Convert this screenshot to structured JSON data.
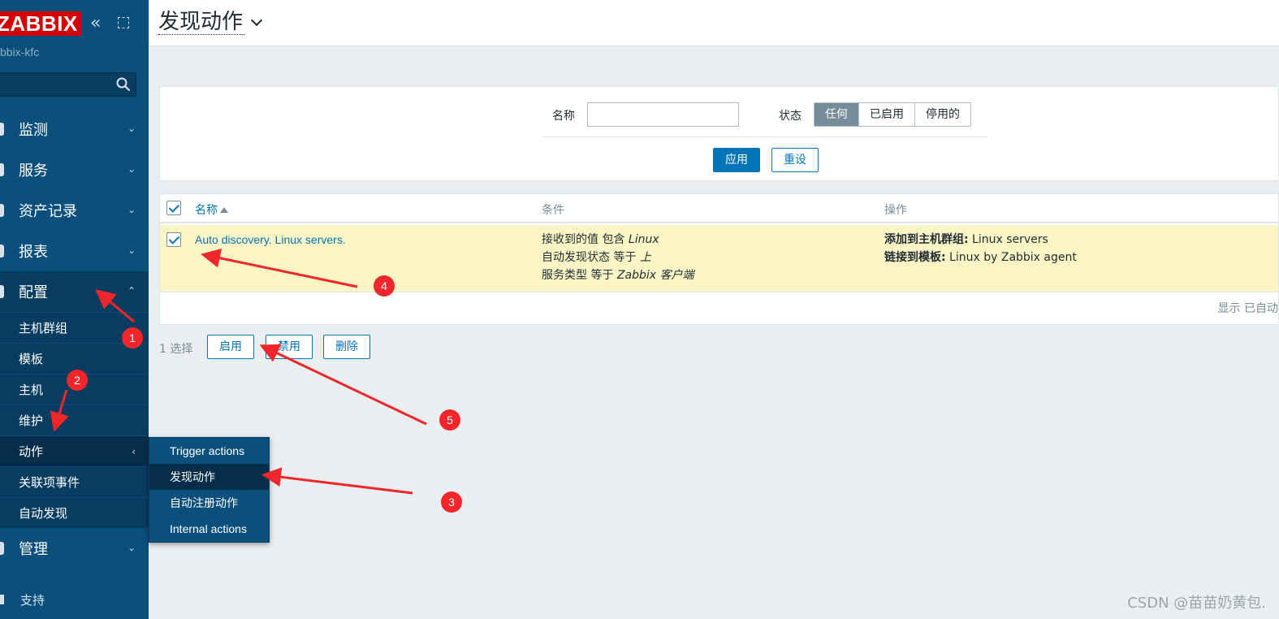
{
  "sidebar": {
    "logo": "ZABBIX",
    "server_name": "bbix-kfc",
    "collapse_icon": "«",
    "menu": [
      {
        "label": "监测",
        "chevron": "⌄"
      },
      {
        "label": "服务",
        "chevron": "⌄"
      },
      {
        "label": "资产记录",
        "chevron": "⌄"
      },
      {
        "label": "报表",
        "chevron": "⌄"
      },
      {
        "label": "配置",
        "chevron": "⌃"
      }
    ],
    "config_submenu": [
      "主机群组",
      "模板",
      "主机",
      "维护",
      "动作",
      "关联项事件",
      "自动发现"
    ],
    "submenu_chevron": "‹",
    "admin": {
      "label": "管理",
      "chevron": "⌄"
    },
    "support": "支持"
  },
  "flyout": [
    "Trigger actions",
    "发现动作",
    "自动注册动作",
    "Internal actions"
  ],
  "header": {
    "title": "发现动作"
  },
  "filter": {
    "name_label": "名称",
    "name_value": "",
    "status_label": "状态",
    "status_options": [
      "任何",
      "已启用",
      "停用的"
    ],
    "apply": "应用",
    "reset": "重设"
  },
  "table": {
    "columns": [
      "名称",
      "条件",
      "操作"
    ],
    "row": {
      "name": "Auto discovery. Linux servers.",
      "conditions": [
        {
          "text": "接收到的值 包含 ",
          "value": "Linux"
        },
        {
          "text": "自动发现状态 等于 ",
          "value": "上"
        },
        {
          "text": "服务类型 等于 ",
          "value": "Zabbix 客户端"
        }
      ],
      "operations": [
        {
          "label": "添加到主机群组:",
          "value": " Linux servers"
        },
        {
          "label": "链接到模板:",
          "value": " Linux by Zabbix agent"
        }
      ]
    },
    "footer": "显示 已自动"
  },
  "actions": {
    "selected": "1 选择",
    "enable": "启用",
    "disable": "禁用",
    "delete": "删除"
  },
  "annotations": [
    "1",
    "2",
    "3",
    "4",
    "5"
  ],
  "watermark": "CSDN @苗苗奶黄包.",
  "colors": {
    "sidebar": "#0b4f7d",
    "accent": "#0275b8",
    "highlight_row": "#fbf5c6",
    "annotation": "#f0262a"
  }
}
